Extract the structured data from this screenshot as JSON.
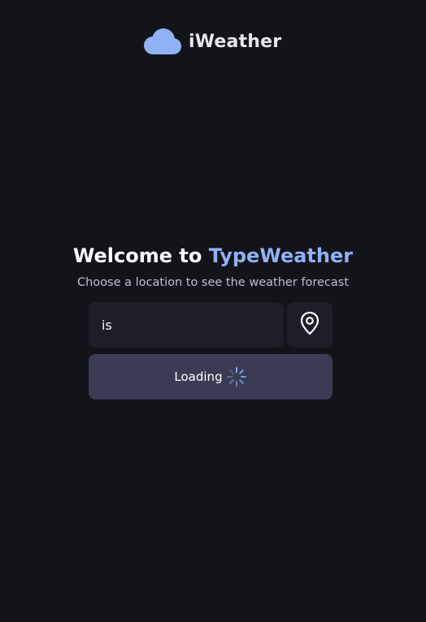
{
  "app": {
    "name": "iWeather",
    "brand_color": "#8fb2f5",
    "logo_icon": "cloud-icon"
  },
  "welcome": {
    "title_prefix": "Welcome to ",
    "title_accent": "TypeWeather",
    "subtitle": "Choose a location to see the weather forecast"
  },
  "search": {
    "value": "is",
    "placeholder": "",
    "location_icon": "map-pin-icon"
  },
  "loading_button": {
    "label": "Loading",
    "icon": "spinner-icon"
  }
}
